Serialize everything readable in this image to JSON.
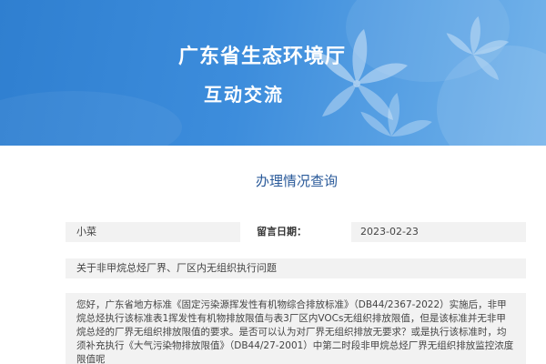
{
  "banner": {
    "title": "广东省生态环境厅",
    "subtitle": "互动交流"
  },
  "section": {
    "title": "办理情况查询"
  },
  "message": {
    "author": "小菜",
    "date_label": "留言日期：",
    "date": "2023-02-23",
    "subject": "关于非甲烷总烃厂界、厂区内无组织执行问题",
    "content": "您好，广东省地方标准《固定污染源挥发性有机物综合排放标准》（DB44/2367-2022）实施后，非甲烷总烃执行该标准表1挥发性有机物排放限值与表3厂区内VOCs无组织排放限值，但是该标准并无非甲烷总烃的厂界无组织排放限值的要求。是否可以认为对厂界无组织排放无要求？或是执行该标准时，均须补充执行《大气污染物排放限值》（DB44/27-2001）中第二时段非甲烷总烃厂界无组织排放监控浓度限值呢"
  },
  "colors": {
    "banner_blue": "#3d8ddc",
    "title_blue": "#2a5a9a",
    "row_gray": "#f2f2f2"
  },
  "icons": {
    "banner_decoration": "lily-flower-icon"
  }
}
